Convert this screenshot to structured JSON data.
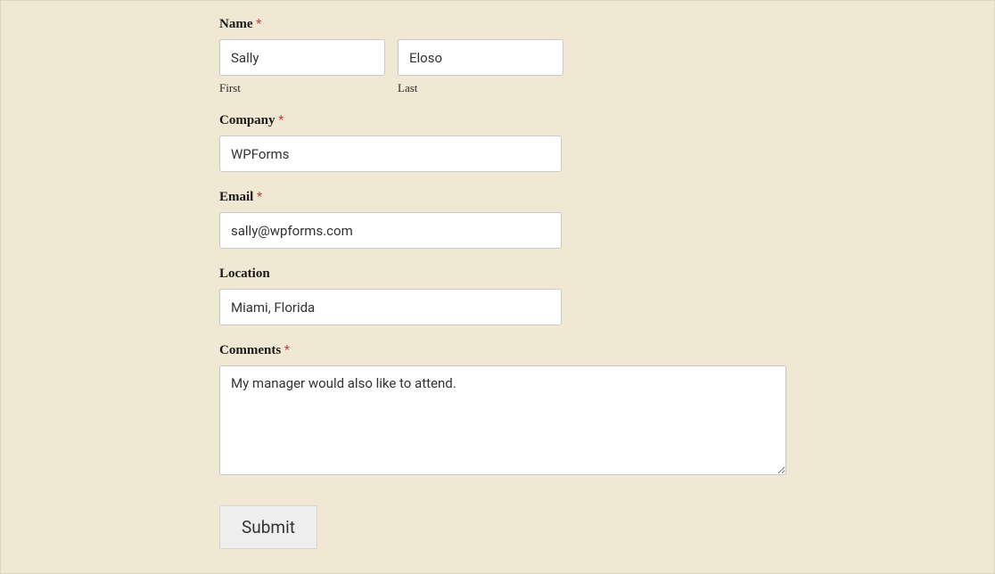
{
  "required_mark": "*",
  "form": {
    "name": {
      "label": "Name",
      "required": true,
      "first": {
        "value": "Sally",
        "sublabel": "First"
      },
      "last": {
        "value": "Eloso",
        "sublabel": "Last"
      }
    },
    "company": {
      "label": "Company",
      "required": true,
      "value": "WPForms"
    },
    "email": {
      "label": "Email",
      "required": true,
      "value": "sally@wpforms.com"
    },
    "location": {
      "label": "Location",
      "required": false,
      "value": "Miami, Florida"
    },
    "comments": {
      "label": "Comments",
      "required": true,
      "value": "My manager would also like to attend."
    },
    "submit": {
      "label": "Submit"
    }
  }
}
